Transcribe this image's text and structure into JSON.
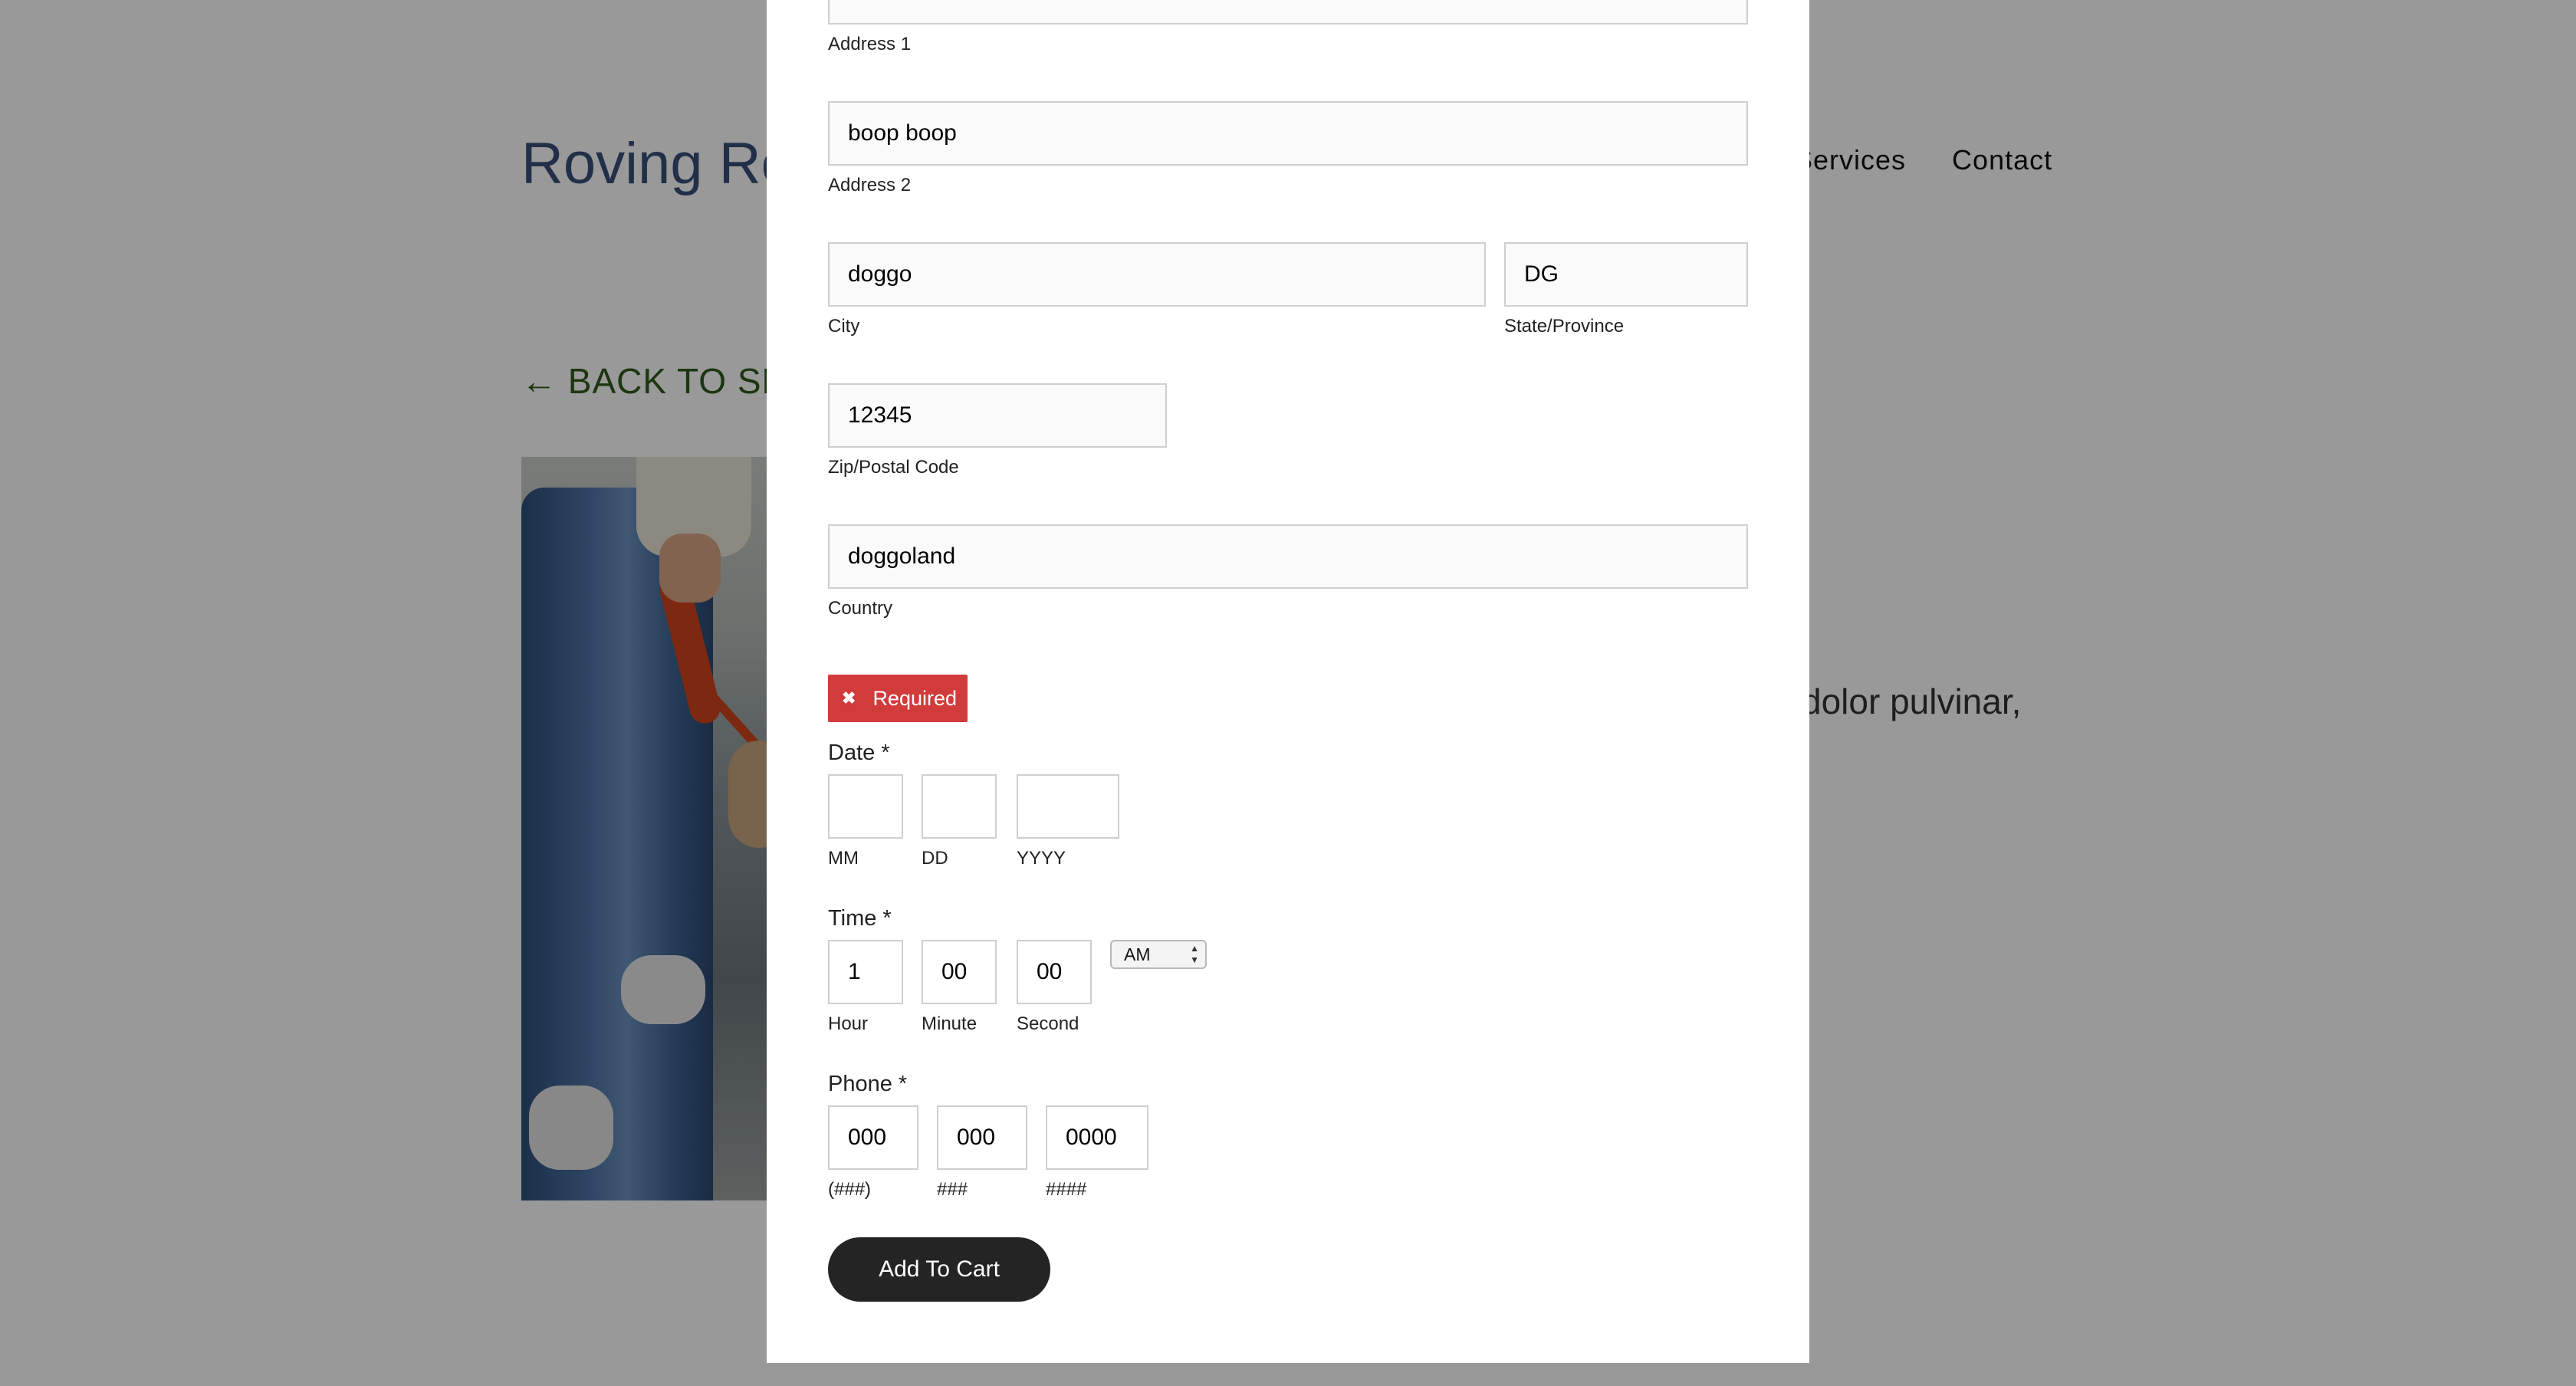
{
  "background": {
    "site_title": "Roving Ro",
    "nav": [
      "Services",
      "Contact"
    ],
    "back_link": "BACK TO SER",
    "back_arrow": "←",
    "description_fragment": "dolor pulvinar,"
  },
  "form": {
    "address1": {
      "value": "",
      "label": "Address 1"
    },
    "address2": {
      "value": "boop boop",
      "label": "Address 2"
    },
    "city": {
      "value": "doggo",
      "label": "City"
    },
    "state": {
      "value": "DG",
      "label": "State/Province"
    },
    "zip": {
      "value": "12345",
      "label": "Zip/Postal Code"
    },
    "country": {
      "value": "doggoland",
      "label": "Country"
    },
    "error": {
      "icon": "✖",
      "text": "Required"
    },
    "date": {
      "label": "Date *",
      "mm": {
        "value": "",
        "label": "MM"
      },
      "dd": {
        "value": "",
        "label": "DD"
      },
      "yyyy": {
        "value": "",
        "label": "YYYY"
      }
    },
    "time": {
      "label": "Time *",
      "hour": {
        "value": "1",
        "label": "Hour"
      },
      "minute": {
        "value": "00",
        "label": "Minute"
      },
      "second": {
        "value": "00",
        "label": "Second"
      },
      "ampm": "AM"
    },
    "phone": {
      "label": "Phone *",
      "area": {
        "value": "000",
        "label": "(###)"
      },
      "prefix": {
        "value": "000",
        "label": "###"
      },
      "line": {
        "value": "0000",
        "label": "####"
      }
    },
    "submit_label": "Add To Cart"
  },
  "colors": {
    "error": "#d23b3b",
    "button": "#242424",
    "site_title": "#3a4f78",
    "back_link": "#2f5a1c"
  }
}
